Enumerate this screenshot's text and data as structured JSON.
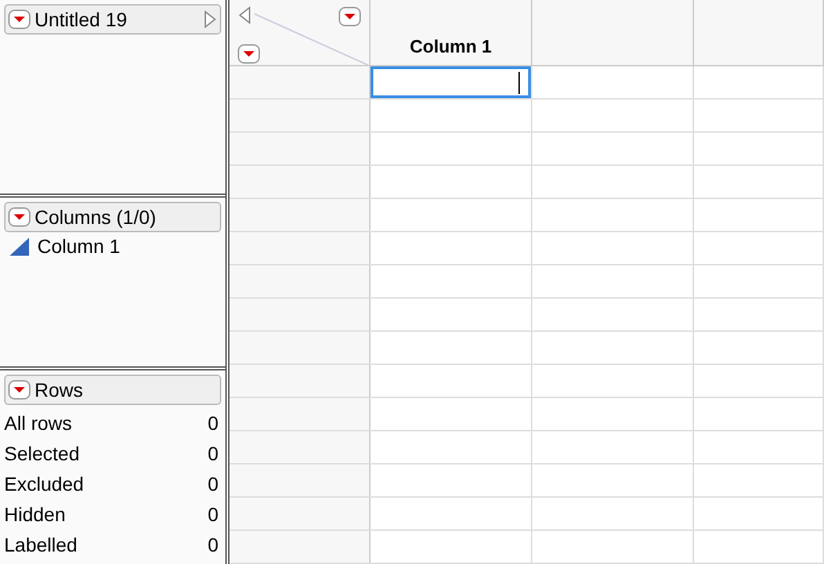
{
  "table_panel": {
    "title": "Untitled 19"
  },
  "columns_panel": {
    "title": "Columns (1/0)",
    "items": [
      {
        "label": "Column 1",
        "kind": "continuous"
      }
    ]
  },
  "rows_panel": {
    "title": "Rows",
    "stats": [
      {
        "label": "All rows",
        "value": "0"
      },
      {
        "label": "Selected",
        "value": "0"
      },
      {
        "label": "Excluded",
        "value": "0"
      },
      {
        "label": "Hidden",
        "value": "0"
      },
      {
        "label": "Labelled",
        "value": "0"
      }
    ]
  },
  "table": {
    "columns": [
      {
        "label": "Column 1",
        "editing": true
      }
    ]
  }
}
